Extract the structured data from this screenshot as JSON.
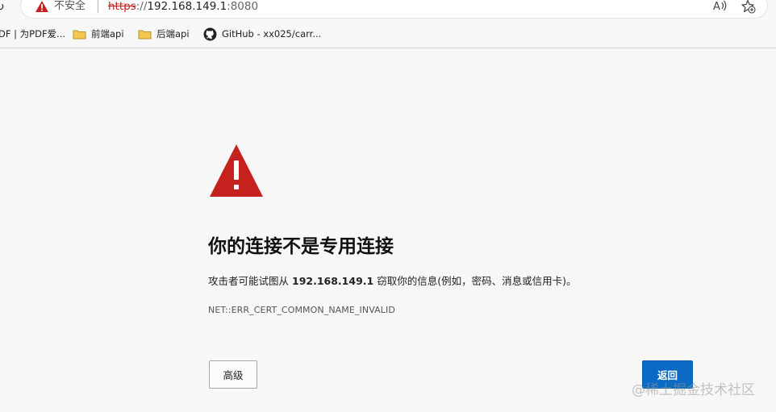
{
  "address_bar": {
    "security_label": "不安全",
    "url_scheme": "https",
    "url_separator": "://",
    "url_host": "192.168.149.1",
    "url_port": ":8080"
  },
  "bookmarks": [
    {
      "label": "DF | 为PDF爱...",
      "icon": "pdf-site-icon"
    },
    {
      "label": "前端api",
      "icon": "folder-icon"
    },
    {
      "label": "后端api",
      "icon": "folder-icon"
    },
    {
      "label": "GitHub - xx025/carr...",
      "icon": "github-icon"
    }
  ],
  "interstitial": {
    "heading": "你的连接不是专用连接",
    "message_prefix": "攻击者可能试图从",
    "message_host": "192.168.149.1",
    "message_suffix": "窃取你的信息(例如，密码、消息或信用卡)。",
    "error_code": "NET::ERR_CERT_COMMON_NAME_INVALID",
    "advanced_button": "高级",
    "back_button": "返回"
  },
  "watermark": "@稀土掘金技术社区",
  "colors": {
    "warning_red": "#c5221f",
    "primary_button": "#0b6bc4",
    "page_background": "#f7f7f7"
  }
}
